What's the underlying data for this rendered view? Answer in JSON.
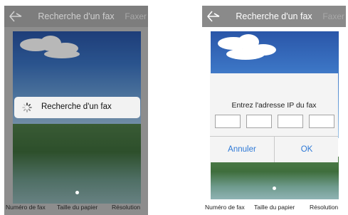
{
  "nav": {
    "title": "Recherche d'un fax",
    "action": "Faxer"
  },
  "loading": {
    "text": "Recherche d'un fax"
  },
  "ip_dialog": {
    "title": "Entrez l'adresse IP du fax",
    "fields": [
      "",
      "",
      "",
      ""
    ],
    "cancel_label": "Annuler",
    "ok_label": "OK"
  },
  "tabs": [
    "Numéro de fax",
    "Taille du papier",
    "Résolution"
  ],
  "colors": {
    "accent_blue": "#2e79d6",
    "navbar_gray": "#8a8a8a",
    "overlay_gray": "#8d8d8d"
  },
  "icons": {
    "back": "back-arrow-icon",
    "spinner": "loading-spinner-icon"
  }
}
